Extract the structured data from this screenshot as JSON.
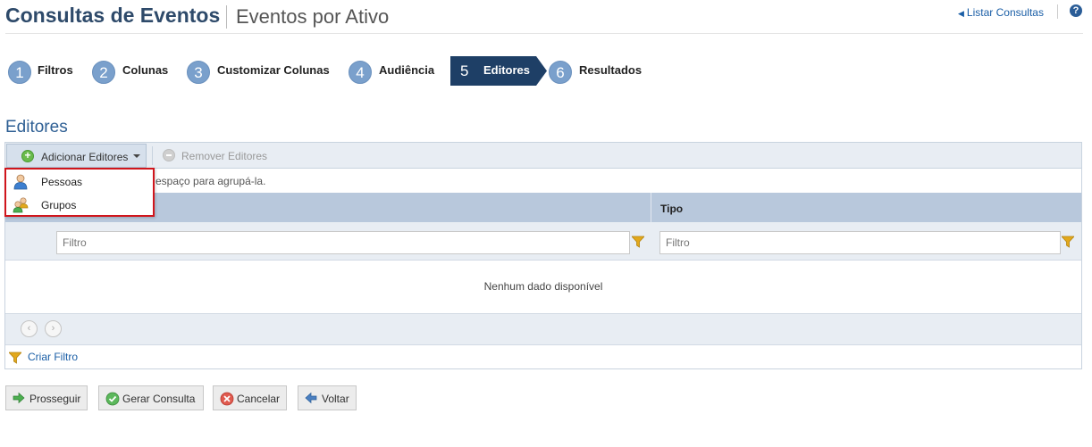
{
  "header": {
    "title": "Consultas de Eventos",
    "subtitle": "Eventos por Ativo",
    "list_link": "Listar Consultas",
    "help_label": "?"
  },
  "steps": [
    {
      "num": "1",
      "label": "Filtros"
    },
    {
      "num": "2",
      "label": "Colunas"
    },
    {
      "num": "3",
      "label": "Customizar Colunas"
    },
    {
      "num": "4",
      "label": "Audiência"
    },
    {
      "num": "5",
      "label": "Editores",
      "active": true
    },
    {
      "num": "6",
      "label": "Resultados"
    }
  ],
  "section": {
    "title": "Editores"
  },
  "toolbar": {
    "add_label": "Adicionar Editores",
    "remove_label": "Remover Editores"
  },
  "dropdown": {
    "items": [
      {
        "label": "Pessoas",
        "icon": "person-icon"
      },
      {
        "label": "Grupos",
        "icon": "group-icon"
      }
    ]
  },
  "grid": {
    "group_hint": "espaço para agrupá-la.",
    "columns": [
      "",
      "Tipo"
    ],
    "filter_placeholder": "Filtro",
    "empty_message": "Nenhum dado disponível",
    "create_filter": "Criar Filtro"
  },
  "buttons": {
    "proceed": "Prosseguir",
    "generate": "Gerar Consulta",
    "cancel": "Cancelar",
    "back": "Voltar"
  },
  "colors": {
    "accent": "#1e3f66",
    "step_circle": "#7aa0cc",
    "header_bg": "#b8c8dc",
    "dropdown_border": "#d0151c"
  }
}
